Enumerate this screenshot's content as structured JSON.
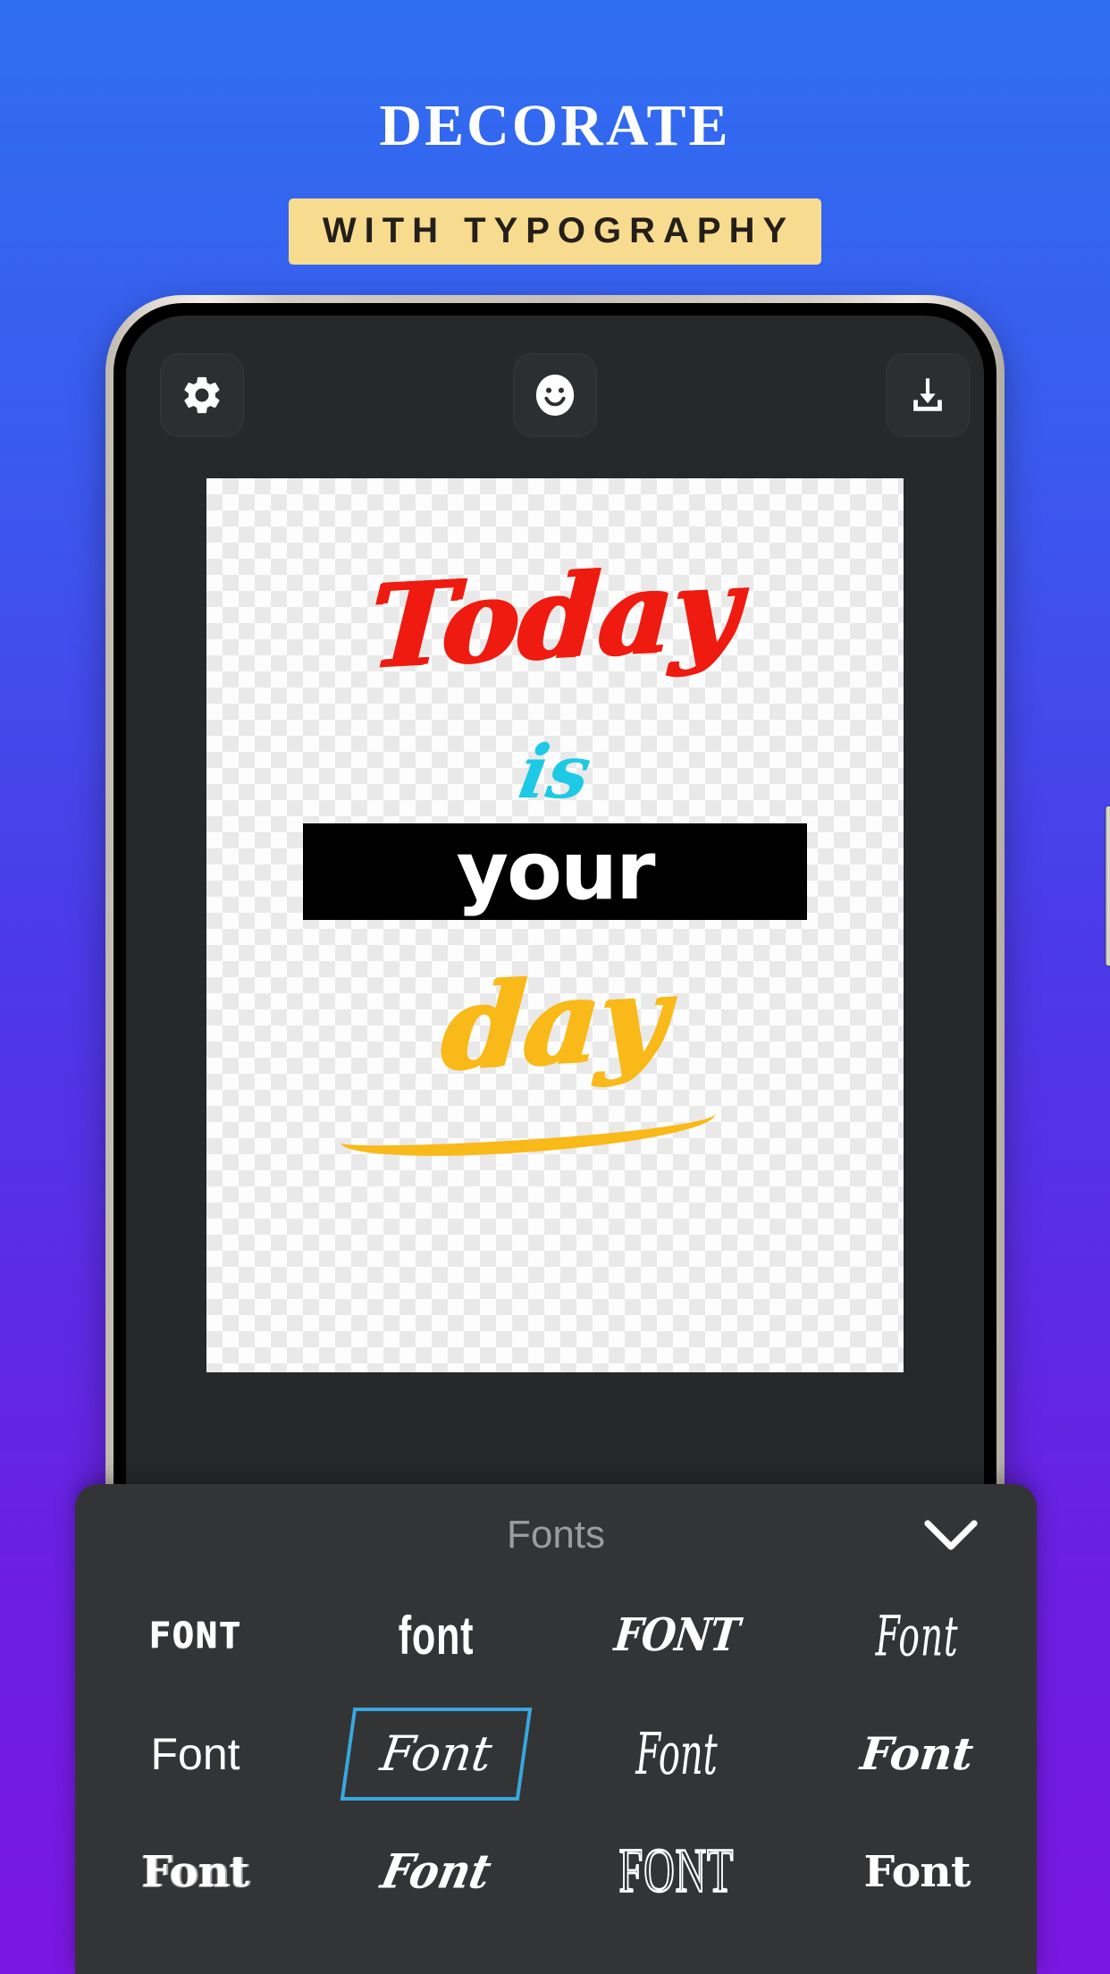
{
  "promo": {
    "title": "DECORATE",
    "subtitle": "WITH TYPOGRAPHY",
    "banner_color": "#f7dc8f",
    "bg_top_color": "#2f6ef0",
    "bg_bottom_color": "#7a17e0"
  },
  "toolbar": {
    "settings_icon": "gear-icon",
    "sticker_icon": "smiley-face-icon",
    "download_icon": "download-icon"
  },
  "canvas": {
    "background": "transparent-checkerboard",
    "words": [
      {
        "text": "Today",
        "color": "#ef1b10",
        "style": "brush-script"
      },
      {
        "text": "is",
        "color": "#1ec9e6",
        "style": "script"
      },
      {
        "text": "your",
        "color": "#ffffff",
        "background": "#000000",
        "style": "rounded-bold"
      },
      {
        "text": "day",
        "color": "#f9b918",
        "style": "brush-script"
      }
    ]
  },
  "fonts_panel": {
    "title": "Fonts",
    "collapse_icon": "chevron-down-icon",
    "selection_color": "#37a8dd",
    "samples": [
      {
        "label": "FONT",
        "style": "distressed-caps",
        "selected": false
      },
      {
        "label": "font",
        "style": "condensed-lowercase",
        "selected": false
      },
      {
        "label": "FONT",
        "style": "graffiti-caps",
        "selected": false
      },
      {
        "label": "Font",
        "style": "gothic-tall",
        "selected": false
      },
      {
        "label": "Font",
        "style": "plain-sans",
        "selected": false
      },
      {
        "label": "Font",
        "style": "cursive-script",
        "selected": true
      },
      {
        "label": "Font",
        "style": "calligraphy-script",
        "selected": false
      },
      {
        "label": "Font",
        "style": "bold-script",
        "selected": false
      },
      {
        "label": "Font",
        "style": "brush-rough",
        "selected": false
      },
      {
        "label": "Font",
        "style": "spiky-horror",
        "selected": false
      },
      {
        "label": "FONT",
        "style": "tall-outline-caps",
        "selected": false
      },
      {
        "label": "Font",
        "style": "bold-rounded-brush",
        "selected": false
      }
    ]
  }
}
